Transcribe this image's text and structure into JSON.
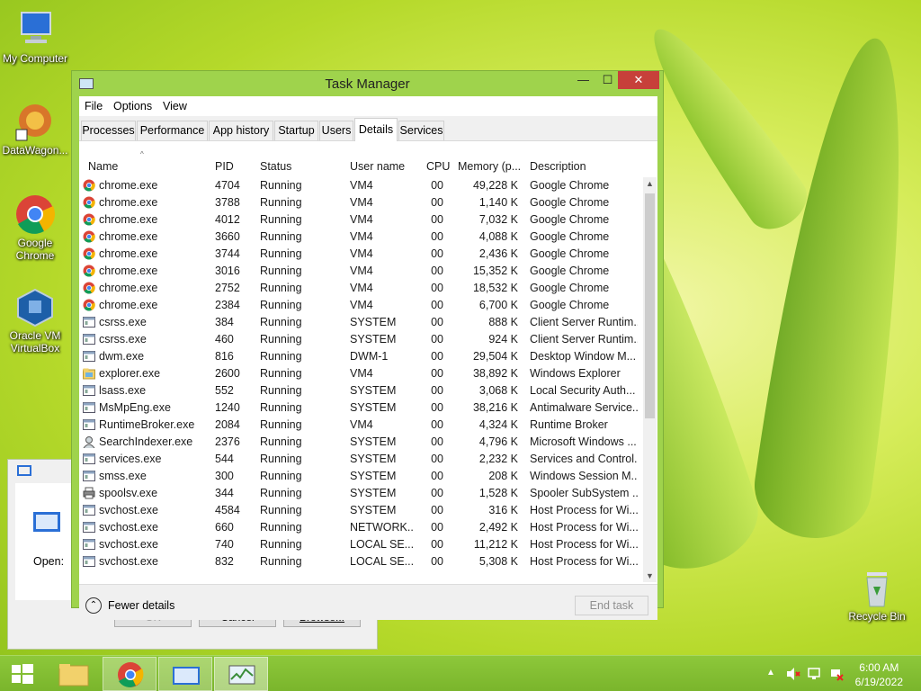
{
  "desktop": {
    "icons": [
      {
        "label": "My Computer"
      },
      {
        "label": "DataWagon..."
      },
      {
        "label": "Google Chrome"
      },
      {
        "label": "Oracle VM VirtualBox"
      },
      {
        "label": "Recycle Bin"
      }
    ]
  },
  "run_dialog": {
    "open_label": "Open:",
    "ok_label": "OK",
    "cancel_label": "Cancel",
    "browse_label": "Browse..."
  },
  "window": {
    "title": "Task Manager",
    "minimize": "—",
    "maximize": "☐",
    "close": "✕",
    "menu": [
      "File",
      "Options",
      "View"
    ],
    "tabs": [
      "Processes",
      "Performance",
      "App history",
      "Startup",
      "Users",
      "Details",
      "Services"
    ],
    "active_tab": "Details"
  },
  "table": {
    "columns": [
      "Name",
      "PID",
      "Status",
      "User name",
      "CPU",
      "Memory (p...",
      "Description"
    ],
    "rows": [
      {
        "icon": "chrome-icon",
        "name": "chrome.exe",
        "pid": "4704",
        "status": "Running",
        "user": "VM4",
        "cpu": "00",
        "mem": "49,228 K",
        "desc": "Google Chrome"
      },
      {
        "icon": "chrome-icon",
        "name": "chrome.exe",
        "pid": "3788",
        "status": "Running",
        "user": "VM4",
        "cpu": "00",
        "mem": "1,140 K",
        "desc": "Google Chrome"
      },
      {
        "icon": "chrome-icon",
        "name": "chrome.exe",
        "pid": "4012",
        "status": "Running",
        "user": "VM4",
        "cpu": "00",
        "mem": "7,032 K",
        "desc": "Google Chrome"
      },
      {
        "icon": "chrome-icon",
        "name": "chrome.exe",
        "pid": "3660",
        "status": "Running",
        "user": "VM4",
        "cpu": "00",
        "mem": "4,088 K",
        "desc": "Google Chrome"
      },
      {
        "icon": "chrome-icon",
        "name": "chrome.exe",
        "pid": "3744",
        "status": "Running",
        "user": "VM4",
        "cpu": "00",
        "mem": "2,436 K",
        "desc": "Google Chrome"
      },
      {
        "icon": "chrome-icon",
        "name": "chrome.exe",
        "pid": "3016",
        "status": "Running",
        "user": "VM4",
        "cpu": "00",
        "mem": "15,352 K",
        "desc": "Google Chrome"
      },
      {
        "icon": "chrome-icon",
        "name": "chrome.exe",
        "pid": "2752",
        "status": "Running",
        "user": "VM4",
        "cpu": "00",
        "mem": "18,532 K",
        "desc": "Google Chrome"
      },
      {
        "icon": "chrome-icon",
        "name": "chrome.exe",
        "pid": "2384",
        "status": "Running",
        "user": "VM4",
        "cpu": "00",
        "mem": "6,700 K",
        "desc": "Google Chrome"
      },
      {
        "icon": "window-icon",
        "name": "csrss.exe",
        "pid": "384",
        "status": "Running",
        "user": "SYSTEM",
        "cpu": "00",
        "mem": "888 K",
        "desc": "Client Server Runtim..."
      },
      {
        "icon": "window-icon",
        "name": "csrss.exe",
        "pid": "460",
        "status": "Running",
        "user": "SYSTEM",
        "cpu": "00",
        "mem": "924 K",
        "desc": "Client Server Runtim..."
      },
      {
        "icon": "window-icon",
        "name": "dwm.exe",
        "pid": "816",
        "status": "Running",
        "user": "DWM-1",
        "cpu": "00",
        "mem": "29,504 K",
        "desc": "Desktop Window M..."
      },
      {
        "icon": "folder-icon",
        "name": "explorer.exe",
        "pid": "2600",
        "status": "Running",
        "user": "VM4",
        "cpu": "00",
        "mem": "38,892 K",
        "desc": "Windows Explorer"
      },
      {
        "icon": "window-icon",
        "name": "lsass.exe",
        "pid": "552",
        "status": "Running",
        "user": "SYSTEM",
        "cpu": "00",
        "mem": "3,068 K",
        "desc": "Local Security Auth..."
      },
      {
        "icon": "window-icon",
        "name": "MsMpEng.exe",
        "pid": "1240",
        "status": "Running",
        "user": "SYSTEM",
        "cpu": "00",
        "mem": "38,216 K",
        "desc": "Antimalware Service..."
      },
      {
        "icon": "window-icon",
        "name": "RuntimeBroker.exe",
        "pid": "2084",
        "status": "Running",
        "user": "VM4",
        "cpu": "00",
        "mem": "4,324 K",
        "desc": "Runtime Broker"
      },
      {
        "icon": "search-user-icon",
        "name": "SearchIndexer.exe",
        "pid": "2376",
        "status": "Running",
        "user": "SYSTEM",
        "cpu": "00",
        "mem": "4,796 K",
        "desc": "Microsoft Windows ..."
      },
      {
        "icon": "window-icon",
        "name": "services.exe",
        "pid": "544",
        "status": "Running",
        "user": "SYSTEM",
        "cpu": "00",
        "mem": "2,232 K",
        "desc": "Services and Control..."
      },
      {
        "icon": "window-icon",
        "name": "smss.exe",
        "pid": "300",
        "status": "Running",
        "user": "SYSTEM",
        "cpu": "00",
        "mem": "208 K",
        "desc": "Windows Session M..."
      },
      {
        "icon": "printer-icon",
        "name": "spoolsv.exe",
        "pid": "344",
        "status": "Running",
        "user": "SYSTEM",
        "cpu": "00",
        "mem": "1,528 K",
        "desc": "Spooler SubSystem ..."
      },
      {
        "icon": "window-icon",
        "name": "svchost.exe",
        "pid": "4584",
        "status": "Running",
        "user": "SYSTEM",
        "cpu": "00",
        "mem": "316 K",
        "desc": "Host Process for Wi..."
      },
      {
        "icon": "window-icon",
        "name": "svchost.exe",
        "pid": "660",
        "status": "Running",
        "user": "NETWORK...",
        "cpu": "00",
        "mem": "2,492 K",
        "desc": "Host Process for Wi..."
      },
      {
        "icon": "window-icon",
        "name": "svchost.exe",
        "pid": "740",
        "status": "Running",
        "user": "LOCAL SE...",
        "cpu": "00",
        "mem": "11,212 K",
        "desc": "Host Process for Wi..."
      },
      {
        "icon": "window-icon",
        "name": "svchost.exe",
        "pid": "832",
        "status": "Running",
        "user": "LOCAL SE...",
        "cpu": "00",
        "mem": "5,308 K",
        "desc": "Host Process for Wi..."
      }
    ]
  },
  "footer": {
    "fewer_details": "Fewer details",
    "end_task": "End task"
  },
  "taskbar": {
    "time": "6:00 AM",
    "date": "6/19/2022",
    "tray_arrow": "▲"
  }
}
